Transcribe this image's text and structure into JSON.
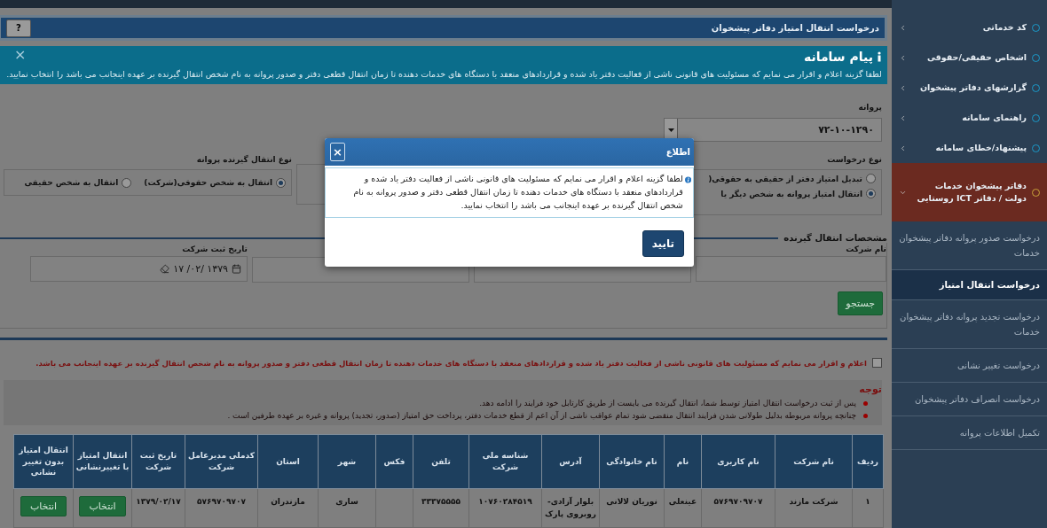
{
  "page_header": {
    "title": "درخواست انتقال امتیاز دفاتر پیشخوان",
    "help_button": "?"
  },
  "system_message": {
    "title": "پیام سامانه",
    "close": "×",
    "text": "لطفا گزینه اعلام و اقرار می نمایم که مسئولیت های قانونی ناشی از فعالیت دفتر یاد شده و قراردادهای منعقد با دستگاه های خدمات دهنده تا زمان انتقال قطعی دفتر و صدور پروانه به نام شخص انتقال گیرنده بر عهده اینجانب می باشد را انتخاب نمایید."
  },
  "license": {
    "label": "پروانه",
    "value": "۷۲-۱۰-۱۲۹۰"
  },
  "request_type": {
    "label": "نوع درخواست",
    "options": [
      {
        "label": "تبدیل امتیاز دفتر از حقیقی به حقوقی(",
        "selected": false
      },
      {
        "label": "انتقال امتیاز پروانه به شخص دیگر یا",
        "selected": true
      }
    ]
  },
  "receiver_type": {
    "label": "نوع انتقال گیرنده پروانه",
    "options": [
      {
        "label": "انتقال به شخص حقوقی(شرکت)",
        "selected": true
      },
      {
        "label": "انتقال به شخص حقیقی",
        "selected": false
      }
    ]
  },
  "receiver_details": {
    "title": "مشخصات انتقال گیرنده",
    "company_name": {
      "label": "نام شرکت"
    },
    "registration_date": {
      "label": "تاریخ ثبت شرکت",
      "value": "۱۳۷۹ /۰۲/ ۱۷"
    },
    "search_button": "جستجو"
  },
  "declaration": {
    "checked": false,
    "text": "اعلام و اقرار می نمایم که مسئولیت های قانونی ناشی از فعالیت دفتر یاد شده و قراردادهای منعقد با دستگاه های خدمات دهنده تا زمان انتقال قطعی دفتر و صدور پروانه به نام شخص انتقال گیرنده بر عهده اینجانب می باشد."
  },
  "notes": {
    "title": "توجه",
    "items": [
      "پس از ثبت درخواست انتقال امتیاز توسط شما، انتقال گیرنده می بایست از طریق کارتابل خود فرایند را ادامه دهد.",
      "چنانچه پروانه مربوطه بدلیل طولانی شدن فرایند انتقال منقضی شود تمام عواقب ناشی از آن اعم از قطع خدمات دفتر، پرداخت حق امتیاز (صدور، تجدید) پروانه و غیره بر عهده طرفین است ."
    ]
  },
  "table": {
    "columns": [
      "ردیف",
      "نام شرکت",
      "نام کاربری",
      "نام",
      "نام خانوادگی",
      "آدرس",
      "شناسه ملی شرکت",
      "تلفن",
      "فکس",
      "شهر",
      "استان",
      "کدملی مدیرعامل شرکت",
      "تاریخ ثبت شرکت",
      "انتقال امتیاز با تغییرنشانی",
      "انتقال امتیاز بدون تغییر نشانی"
    ],
    "rows": [
      {
        "cells": [
          "۱",
          "شرکت مازند",
          "۵۷۶۹۷۰۹۷۰۷",
          "عینعلی",
          "نوریان لالانی",
          "بلوار آزادی- روبروی پارک",
          "۱۰۷۶۰۲۸۴۵۱۹",
          "۳۳۳۷۵۵۵۵",
          "",
          "ساری",
          "مازندران",
          "۵۷۶۹۷۰۹۷۰۷",
          "۱۳۷۹/۰۲/۱۷"
        ],
        "buttons": [
          "انتخاب",
          "انتخاب"
        ]
      }
    ]
  },
  "modal": {
    "title": "اطلاع",
    "close": "×",
    "text": "لطفا گزینه اعلام و اقرار می نمایم که مسئولیت های قانونی ناشی از فعالیت دفتر یاد شده و قراردادهای منعقد با دستگاه های خدمات دهنده تا زمان انتقال قطعی دفتر و صدور پروانه به نام شخص انتقال گیرنده بر عهده اینجانب می باشد را انتخاب نمایید.",
    "confirm": "تایید"
  },
  "sidebar": {
    "items": [
      {
        "label": "کد خدماتی",
        "expanded": false
      },
      {
        "label": "اشخاص حقیقی/حقوقی",
        "expanded": false
      },
      {
        "label": "گزارشهای دفاتر پیشخوان",
        "expanded": false
      },
      {
        "label": "راهنمای سامانه",
        "expanded": false
      },
      {
        "label": "پیشنهاد/خطای سامانه",
        "expanded": false
      },
      {
        "label": "دفاتر پیشخوان خدمات دولت / دفاتر ICT روستایی",
        "expanded": true,
        "children": [
          {
            "label": "درخواست صدور پروانه دفاتر پیشخوان خدمات",
            "selected": false
          },
          {
            "label": "درخواست انتقال امتیاز",
            "selected": true
          },
          {
            "label": "درخواست تجدید پروانه دفاتر پیشخوان خدمات",
            "selected": false
          },
          {
            "label": "درخواست تغییر نشانی",
            "selected": false
          },
          {
            "label": "درخواست انصراف دفاتر پیشخوان",
            "selected": false
          },
          {
            "label": "تکمیل اطلاعات پروانه",
            "selected": false
          }
        ]
      }
    ]
  }
}
